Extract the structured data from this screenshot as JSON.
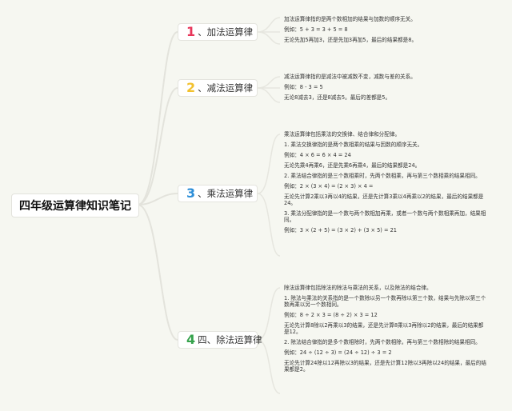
{
  "root": {
    "title": "四年级运算律知识笔记"
  },
  "branches": [
    {
      "num": "1",
      "label": "、加法运算律",
      "color": "#e8365a",
      "lines": [
        "加法运算律指的是两个数相加的结果与加数的顺序无关。",
        "例如：5 + 3 = 3 + 5 = 8",
        "无论先加5再加3，还是先加3再加5，最后的结果都是8。"
      ]
    },
    {
      "num": "2",
      "label": "、减法运算律",
      "color": "#f2c12e",
      "lines": [
        "减法运算律指的是减法中被减数不变，减数与差的关系。",
        "例如：8 - 3 = 5",
        "无论8减去3，还是8减去5。最后的差都是5。"
      ]
    },
    {
      "num": "3",
      "label": "、乘法运算律",
      "color": "#2e8fd8",
      "lines": [
        "乘法运算律包括乘法的交换律、结合律和分配律。",
        "1. 乘法交换律指的是两个数相乘的结果与因数的顺序无关。",
        "例如：4 × 6 = 6 × 4 = 24",
        "无论先乘4再乘6，还是先乘6再乘4，最后的结果都是24。",
        "2. 乘法结合律指的是三个数相乘时，先两个数相乘，再与第三个数相乘的结果相同。",
        "例如：2 × (3 × 4) = (2 × 3) × 4 =",
        "无论先计算2乘以3再以4的结果，还是先计算3乘以4再乘以2的结果，最后的结果都是24。",
        "3. 乘法分配律指的是一个数与两个数相加再乘，或者一个数与两个数相乘再加，结果相同。",
        "例如：3 × (2 + 5) = (3 × 2) + (3 × 5) = 21"
      ]
    },
    {
      "num": "4",
      "label": "四、除法运算律",
      "color": "#35a24b",
      "lines": [
        "除法运算律包括除法的除法与乘法的关系，以及除法的结合律。",
        "1. 除法与乘法的关系指的是一个数除以另一个数再除以第三个数，结果与先除以第三个数再乘以另一个数相同。",
        "例如：8 ÷ 2 × 3 = (8 ÷ 2) × 3 = 12",
        "无论先计算8除以2再乘以3的结果，还是先计算8乘以3再除以2的结果，最后的结果都是12。",
        "2. 除法结合律指的是多个数相除时，先两个数相除，再与第三个数相除的结果相同。",
        "例如：24 ÷ (12 ÷ 3) = (24 ÷ 12) ÷ 3 = 2",
        "无论先计算24除以12再除以3的结果，还是先计算12除以3再除以24的结果，最后的结果都是2。"
      ]
    }
  ]
}
